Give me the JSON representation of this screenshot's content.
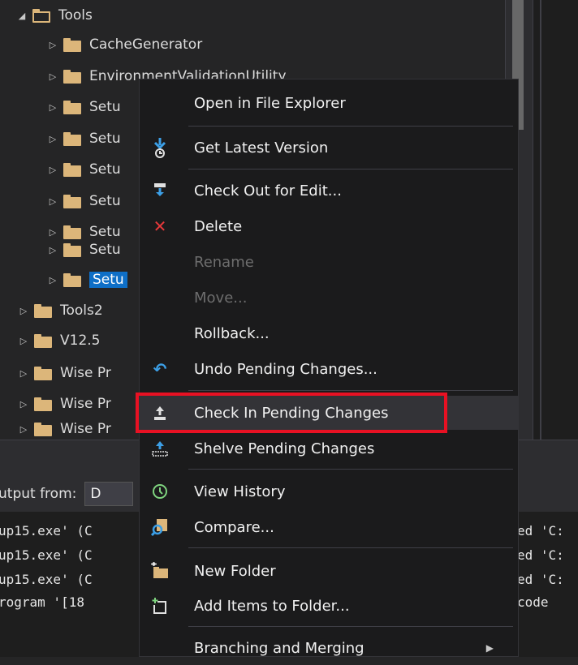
{
  "tree": {
    "items": [
      {
        "label": "Tools",
        "expanded": true,
        "indent": 0
      },
      {
        "label": "CacheGenerator",
        "indent": 1
      },
      {
        "label": "EnvironmentValidationUtility",
        "indent": 1
      },
      {
        "label": "Setu",
        "indent": 1
      },
      {
        "label": "Setu",
        "indent": 1
      },
      {
        "label": "Setu",
        "indent": 1
      },
      {
        "label": "Setu",
        "indent": 1
      },
      {
        "label": "Setu",
        "indent": 1
      },
      {
        "label": "Setu",
        "indent": 1
      },
      {
        "label": "Setu",
        "indent": 1,
        "selected": true
      },
      {
        "label": "Tools2",
        "indent": 0
      },
      {
        "label": "V12.5",
        "indent": 0
      },
      {
        "label": "Wise Pr",
        "indent": 0
      },
      {
        "label": "Wise Pr",
        "indent": 0
      },
      {
        "label": "Wise Pr",
        "indent": 0
      }
    ]
  },
  "output": {
    "label": "utput from:",
    "selected": "D",
    "lines": [
      "up15.exe' (C",
      "up15.exe' (C",
      "up15.exe' (C",
      "rogram '[18"
    ],
    "right_lines": [
      "ed 'C:",
      "ed 'C:",
      "ed 'C:",
      "code"
    ]
  },
  "context_menu": {
    "items": [
      {
        "label": "Open in File Explorer",
        "icon": "none"
      },
      {
        "label": "Get Latest Version",
        "icon": "get-latest-icon"
      },
      {
        "label": "Check Out for Edit...",
        "icon": "check-out-icon"
      },
      {
        "label": "Delete",
        "icon": "delete-icon"
      },
      {
        "label": "Rename",
        "icon": "none",
        "disabled": true
      },
      {
        "label": "Move...",
        "icon": "none",
        "disabled": true
      },
      {
        "label": "Rollback...",
        "icon": "none"
      },
      {
        "label": "Undo Pending Changes...",
        "icon": "undo-icon"
      },
      {
        "label": "Check In Pending Changes",
        "icon": "check-in-icon",
        "highlighted": true
      },
      {
        "label": "Shelve Pending Changes",
        "icon": "shelve-icon"
      },
      {
        "label": "View History",
        "icon": "history-icon"
      },
      {
        "label": "Compare...",
        "icon": "compare-icon"
      },
      {
        "label": "New Folder",
        "icon": "new-folder-icon"
      },
      {
        "label": "Add Items to Folder...",
        "icon": "add-items-icon"
      },
      {
        "label": "Branching and Merging",
        "icon": "none",
        "submenu": true
      }
    ]
  },
  "colors": {
    "background": "#252526",
    "menu_bg": "#1b1b1c",
    "selection": "#0e6fc7",
    "highlight_outline": "#e81123",
    "folder": "#dcb67a"
  }
}
